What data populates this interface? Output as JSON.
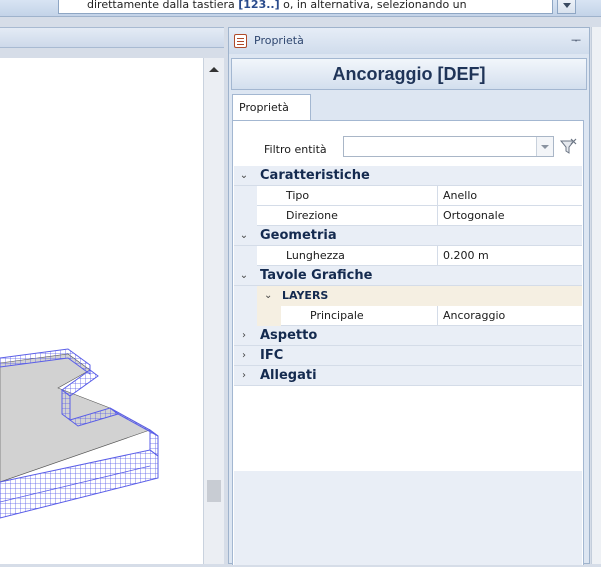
{
  "command_bar": {
    "text_prefix": "direttamente dalla tastiera ",
    "text_bold": "[123..]",
    "text_suffix": " o, in alternativa, selezionando un"
  },
  "panel": {
    "title": "Proprietà",
    "pin_glyph": "📌",
    "header": "Ancoraggio [DEF]",
    "tab_label": "Proprietà",
    "filter_label": "Filtro entità",
    "filter_value": ""
  },
  "grid": {
    "cat_caratteristiche": "Caratteristiche",
    "tipo_name": "Tipo",
    "tipo_value": "Anello",
    "direzione_name": "Direzione",
    "direzione_value": "Ortogonale",
    "cat_geometria": "Geometria",
    "lunghezza_name": "Lunghezza",
    "lunghezza_value": "0.200 m",
    "cat_tavole": "Tavole Grafiche",
    "sub_layers": "LAYERS",
    "principale_name": "Principale",
    "principale_value": "Ancoraggio",
    "cat_aspetto": "Aspetto",
    "cat_ifc": "IFC",
    "cat_allegati": "Allegati"
  },
  "colors": {
    "accent_blue": "#142a4f",
    "mesh_blue": "#5a5ee8",
    "slab_gray": "#d2d2d2"
  }
}
